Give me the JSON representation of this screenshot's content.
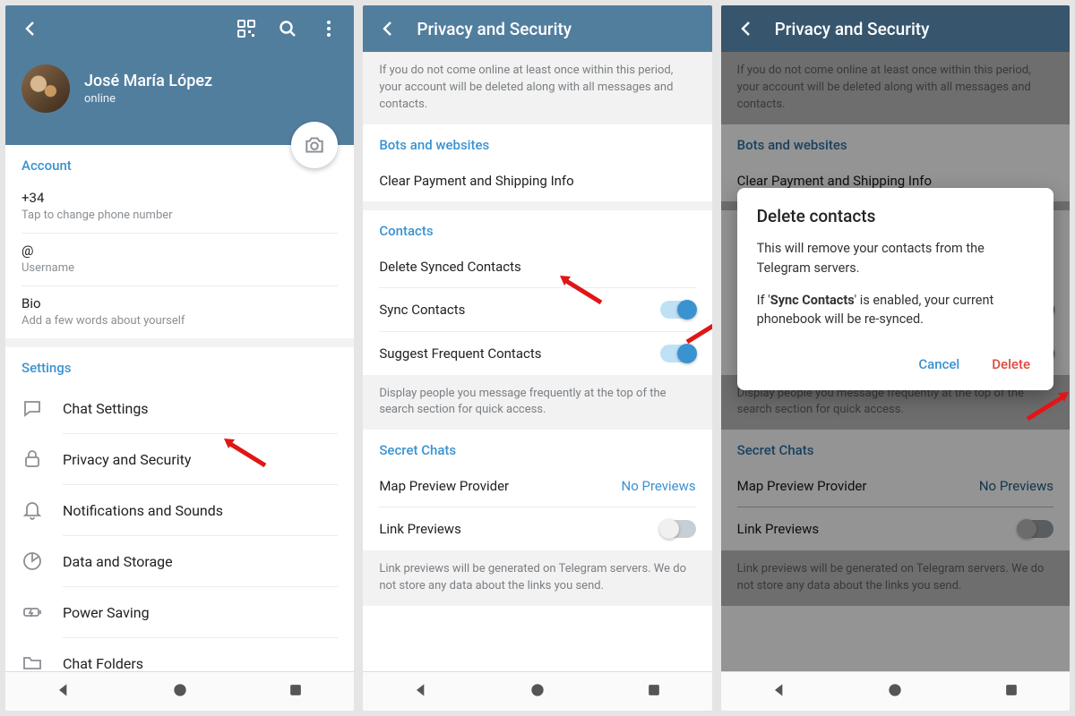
{
  "colors": {
    "accent": "#3a92d0",
    "danger": "#e0483e",
    "header": "#527e9e"
  },
  "screen1": {
    "profile": {
      "name": "José María López",
      "status": "online"
    },
    "account_section": "Account",
    "phone": {
      "value": "+34",
      "sub": "Tap to change phone number"
    },
    "username": {
      "value": "@",
      "sub": "Username"
    },
    "bio": {
      "value": "Bio",
      "sub": "Add a few words about yourself"
    },
    "settings_section": "Settings",
    "settings": {
      "chat": "Chat Settings",
      "privacy": "Privacy and Security",
      "notifications": "Notifications and Sounds",
      "data": "Data and Storage",
      "power": "Power Saving",
      "folders": "Chat Folders"
    }
  },
  "screen2": {
    "title": "Privacy and Security",
    "info_delete": "If you do not come online at least once within this period, your account will be deleted along with all messages and contacts.",
    "bots_section": "Bots and websites",
    "clear_payment": "Clear Payment and Shipping Info",
    "contacts_section": "Contacts",
    "delete_synced": "Delete Synced Contacts",
    "sync_contacts": "Sync Contacts",
    "suggest_frequent": "Suggest Frequent Contacts",
    "info_frequent": "Display people you message frequently at the top of the search section for quick access.",
    "secret_section": "Secret Chats",
    "map_preview": "Map Preview Provider",
    "map_value": "No Previews",
    "link_previews": "Link Previews",
    "info_links": "Link previews will be generated on Telegram servers. We do not store any data about the links you send."
  },
  "screen3": {
    "title": "Privacy and Security",
    "dialog": {
      "title": "Delete contacts",
      "body1": "This will remove your contacts from the Telegram servers.",
      "body2_pre": "If '",
      "body2_bold": "Sync Contacts",
      "body2_post": "' is enabled, your current phonebook will be re-synced.",
      "cancel": "Cancel",
      "delete": "Delete"
    }
  }
}
